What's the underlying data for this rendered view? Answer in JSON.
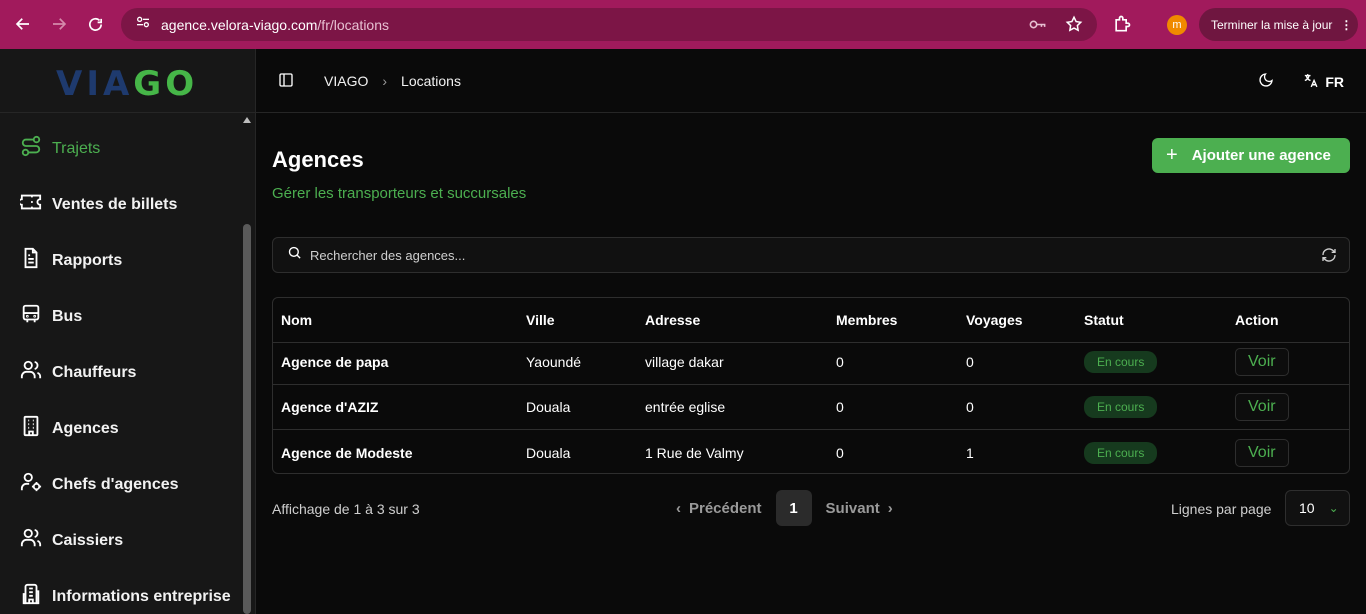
{
  "browser": {
    "url_host": "agence.velora-viago.com",
    "url_path": "/fr/locations",
    "update_label": "Terminer la mise à jour",
    "avatar_letter": "m"
  },
  "sidebar": {
    "logo_part1": "VIA",
    "logo_part2": "GO",
    "items": [
      {
        "label": "Trajets",
        "icon": "route-icon"
      },
      {
        "label": "Ventes de billets",
        "icon": "ticket-icon"
      },
      {
        "label": "Rapports",
        "icon": "report-icon"
      },
      {
        "label": "Bus",
        "icon": "bus-icon"
      },
      {
        "label": "Chauffeurs",
        "icon": "users-icon"
      },
      {
        "label": "Agences",
        "icon": "building-icon"
      },
      {
        "label": "Chefs d'agences",
        "icon": "user-gear-icon"
      },
      {
        "label": "Caissiers",
        "icon": "users-icon"
      },
      {
        "label": "Informations entreprise",
        "icon": "company-icon"
      }
    ]
  },
  "header": {
    "breadcrumb_root": "VIAGO",
    "breadcrumb_current": "Locations",
    "language": "FR"
  },
  "page": {
    "title": "Agences",
    "subtitle": "Gérer les transporteurs et succursales",
    "add_button": "Ajouter une agence",
    "search_placeholder": "Rechercher des agences..."
  },
  "table": {
    "columns": [
      "Nom",
      "Ville",
      "Adresse",
      "Membres",
      "Voyages",
      "Statut",
      "Action"
    ],
    "rows": [
      {
        "nom": "Agence de papa",
        "ville": "Yaoundé",
        "adresse": "village dakar",
        "membres": "0",
        "voyages": "0",
        "statut": "En cours",
        "action": "Voir"
      },
      {
        "nom": "Agence d'AZIZ",
        "ville": "Douala",
        "adresse": "entrée eglise",
        "membres": "0",
        "voyages": "0",
        "statut": "En cours",
        "action": "Voir"
      },
      {
        "nom": "Agence de Modeste",
        "ville": "Douala",
        "adresse": "1 Rue de Valmy",
        "membres": "0",
        "voyages": "1",
        "statut": "En cours",
        "action": "Voir"
      }
    ]
  },
  "footer": {
    "info": "Affichage de 1 à 3 sur 3",
    "prev_label": "Précédent",
    "current_page": "1",
    "next_label": "Suivant",
    "rows_label": "Lignes par page",
    "rows_value": "10"
  },
  "colors": {
    "accent": "#4caf50",
    "browser_chrome": "#a11a5c",
    "logo_blue": "#1e3a6e"
  }
}
